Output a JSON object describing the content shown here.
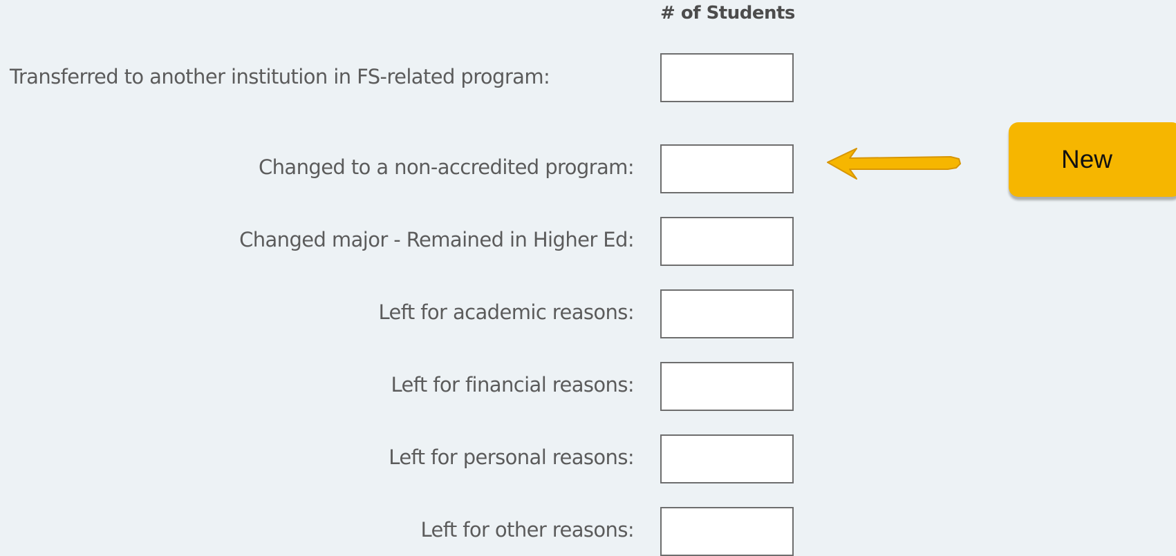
{
  "form": {
    "column_header": "# of Students",
    "rows": [
      {
        "label": "Transferred to another institution in FS-related program:",
        "value": ""
      },
      {
        "label": "Changed to a non-accredited program:",
        "value": ""
      },
      {
        "label": "Changed major - Remained in Higher Ed:",
        "value": ""
      },
      {
        "label": "Left for academic reasons:",
        "value": ""
      },
      {
        "label": "Left for financial reasons:",
        "value": ""
      },
      {
        "label": "Left for personal reasons:",
        "value": ""
      },
      {
        "label": "Left for other reasons:",
        "value": ""
      }
    ]
  },
  "callout": {
    "label": "New",
    "arrow_icon": "arrow-left-icon",
    "color": "#f6b600"
  }
}
